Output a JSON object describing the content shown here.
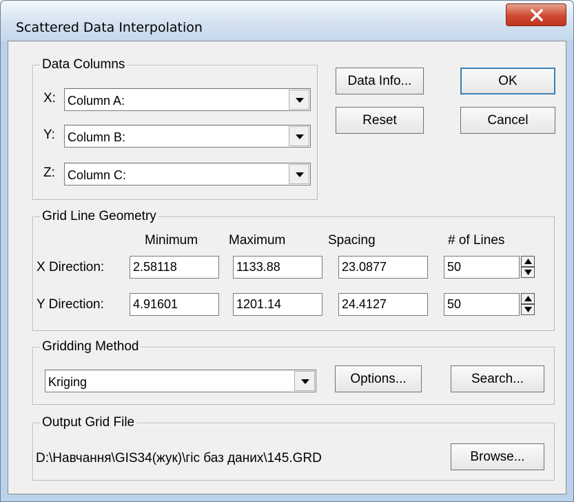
{
  "window": {
    "title": "Scattered Data Interpolation",
    "close_glyph": "X"
  },
  "data_columns": {
    "legend": "Data Columns",
    "x_label": "X:",
    "y_label": "Y:",
    "z_label": "Z:",
    "x_value": "Column A:",
    "y_value": "Column B:",
    "z_value": "Column C:"
  },
  "buttons": {
    "data_info": "Data Info...",
    "ok": "OK",
    "reset": "Reset",
    "cancel": "Cancel",
    "options": "Options...",
    "search": "Search...",
    "browse": "Browse..."
  },
  "grid_geometry": {
    "legend": "Grid Line Geometry",
    "headers": [
      "Minimum",
      "Maximum",
      "Spacing",
      "# of Lines"
    ],
    "rows": [
      {
        "label": "X Direction:",
        "minimum": "2.58118",
        "maximum": "1133.88",
        "spacing": "23.0877",
        "lines": "50"
      },
      {
        "label": "Y Direction:",
        "minimum": "4.91601",
        "maximum": "1201.14",
        "spacing": "24.4127",
        "lines": "50"
      }
    ]
  },
  "gridding_method": {
    "legend": "Gridding Method",
    "value": "Kriging"
  },
  "output_grid": {
    "legend": "Output Grid File",
    "path": "D:\\Навчання\\GIS34(жук)\\гіс баз даних\\145.GRD"
  },
  "icons": {
    "close": "close-icon",
    "dropdown": "chevron-down-icon",
    "spin_up": "arrow-up-icon",
    "spin_down": "arrow-down-icon"
  },
  "colors": {
    "close_button": "#c9432d",
    "default_button_border": "#3c7fb1",
    "dialog_face": "#f0f0f0",
    "frame": "#bcd2ea"
  }
}
